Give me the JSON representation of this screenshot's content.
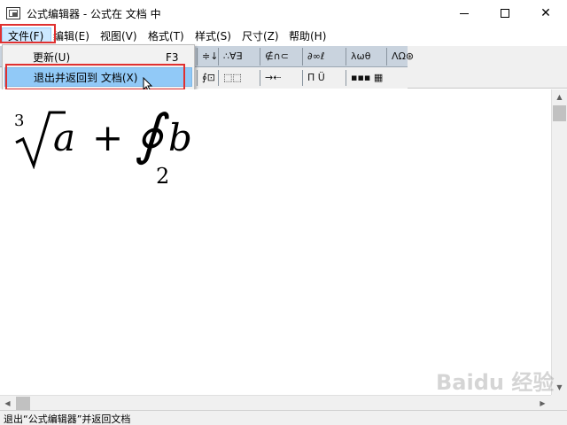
{
  "window": {
    "title": "公式编辑器 - 公式在 文档 中",
    "controls": {
      "minimize": "—",
      "maximize": "☐",
      "close": "✕"
    }
  },
  "menubar": {
    "items": [
      {
        "label": "文件(F)"
      },
      {
        "label": "编辑(E)"
      },
      {
        "label": "视图(V)"
      },
      {
        "label": "格式(T)"
      },
      {
        "label": "样式(S)"
      },
      {
        "label": "尺寸(Z)"
      },
      {
        "label": "帮助(H)"
      }
    ]
  },
  "dropdown": {
    "items": [
      {
        "label": "更新(U)",
        "shortcut": "F3"
      },
      {
        "label": "退出并返回到 文档(X)",
        "shortcut": ""
      }
    ]
  },
  "toolbar": {
    "row1": [
      "≑↓",
      "∴∀∃",
      "∉∩⊂",
      "∂∞ℓ",
      "λωθ",
      "ΛΩ⊛"
    ],
    "row2": [
      "∮⊡",
      "⬚⬚",
      "→⇠",
      "Π̈ Ü",
      "▪▪▪ ▦"
    ]
  },
  "formula": {
    "index": "3",
    "radical": "√",
    "var_a": "a",
    "plus": "+",
    "integral": "∮",
    "lower_limit": "2",
    "var_b": "b"
  },
  "scrollbars": {
    "up": "▲",
    "down": "▼",
    "left": "◀",
    "right": "▶"
  },
  "statusbar": {
    "text": "退出“公式编辑器”并返回文档"
  },
  "watermark": {
    "text": "Baidu 经验"
  }
}
